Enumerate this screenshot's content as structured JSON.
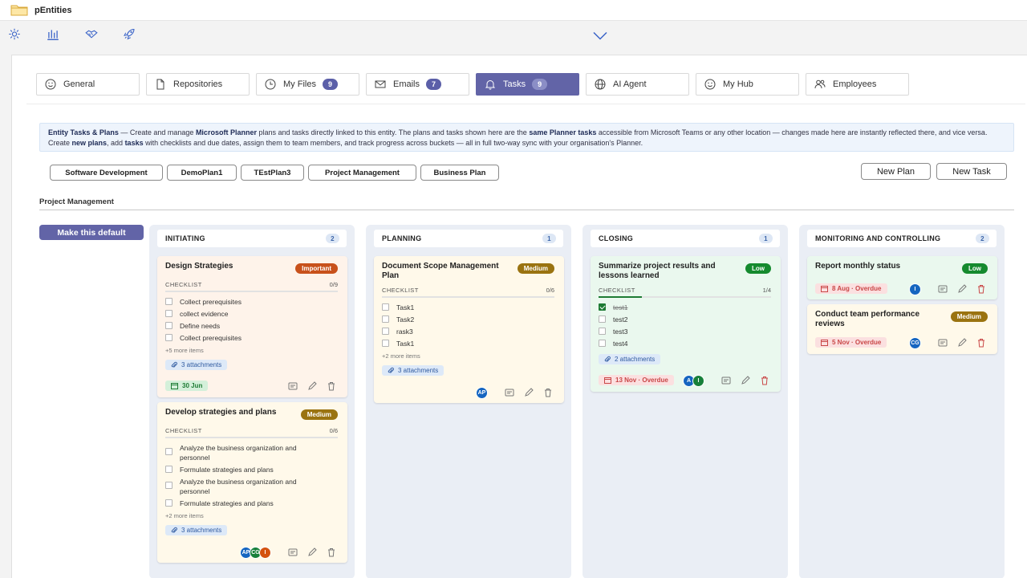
{
  "app": {
    "title": "pEntities"
  },
  "tabs": [
    {
      "label": "General",
      "icon": "smile-icon",
      "badge": ""
    },
    {
      "label": "Repositories",
      "icon": "file-icon",
      "badge": ""
    },
    {
      "label": "My Files",
      "icon": "clock-icon",
      "badge": "9"
    },
    {
      "label": "Emails",
      "icon": "mail-icon",
      "badge": "7"
    },
    {
      "label": "Tasks",
      "icon": "bell-icon",
      "badge": "9",
      "active": true
    },
    {
      "label": "AI Agent",
      "icon": "globe-icon",
      "badge": ""
    },
    {
      "label": "My Hub",
      "icon": "smile-icon",
      "badge": ""
    },
    {
      "label": "Employees",
      "icon": "people-icon",
      "badge": ""
    }
  ],
  "info": {
    "t1": "Entity Tasks & Plans",
    "t2": " — Create and manage ",
    "t3": "Microsoft Planner",
    "t4": " plans and tasks directly linked to this entity. The plans and tasks shown here are the ",
    "t5": "same Planner tasks",
    "t6": " accessible from Microsoft Teams or any other location — changes made here are instantly reflected there, and vice versa. Create ",
    "t7": "new plans",
    "t8": ", add ",
    "t9": "tasks",
    "t10": " with checklists and due dates, assign them to team members, and track progress across buckets — all in full two-way sync with your organisation's Planner."
  },
  "plans": [
    "Software Development",
    "DemoPlan1",
    "TEstPlan3",
    "Project Management",
    "Business Plan"
  ],
  "actions": {
    "new_plan": "New Plan",
    "new_task": "New Task"
  },
  "current_plan": "Project Management",
  "default_button": "Make this default",
  "checklist_label": "CHECKLIST",
  "colors": {
    "accent": "#6264a7",
    "important": "#c8511b",
    "medium": "#9a7310",
    "low": "#158a2e",
    "overdue": "#c94747"
  },
  "buckets": [
    {
      "name": "INITIATING",
      "count": "2",
      "tasks": [
        {
          "title": "Design Strategies",
          "priority": "Important",
          "checklist": "0/9",
          "items": [
            "Collect prerequisites",
            "collect evidence",
            "Define needs",
            "Collect prerequisites"
          ],
          "more": "+5 more items",
          "attachments": "3 attachments",
          "date": "30 Jun"
        },
        {
          "title": "Develop strategies and plans",
          "priority": "Medium",
          "checklist": "0/6",
          "items": [
            "Analyze the business organization and personnel",
            "Formulate strategies and plans",
            "Analyze the business organization and personnel",
            "Formulate strategies and plans"
          ],
          "more": "+2 more items",
          "attachments": "3 attachments",
          "assignees": [
            "AP",
            "CG",
            "I"
          ]
        }
      ]
    },
    {
      "name": "PLANNING",
      "count": "1",
      "tasks": [
        {
          "title": "Document Scope Management Plan",
          "priority": "Medium",
          "checklist": "0/6",
          "items": [
            "Task1",
            "Task2",
            "rask3",
            "Task1"
          ],
          "more": "+2 more items",
          "attachments": "3 attachments",
          "assignees": [
            "AP"
          ]
        }
      ]
    },
    {
      "name": "CLOSING",
      "count": "1",
      "tasks": [
        {
          "title": "Summarize project results and lessons learned",
          "priority": "Low",
          "checklist": "1/4",
          "progress": 0.25,
          "items": [
            "test1",
            "test2",
            "test3",
            "test4"
          ],
          "attachments": "2 attachments",
          "date": "13 Nov · Overdue",
          "assignees": [
            "A",
            "I"
          ]
        }
      ]
    },
    {
      "name": "MONITORING AND CONTROLLING",
      "count": "2",
      "tasks": [
        {
          "title": "Report monthly status",
          "priority": "Low",
          "date": "8 Aug · Overdue",
          "assignees": [
            "I"
          ]
        },
        {
          "title": "Conduct team performance reviews",
          "priority": "Medium",
          "date": "5 Nov · Overdue",
          "assignees": [
            "CG"
          ]
        }
      ]
    }
  ]
}
